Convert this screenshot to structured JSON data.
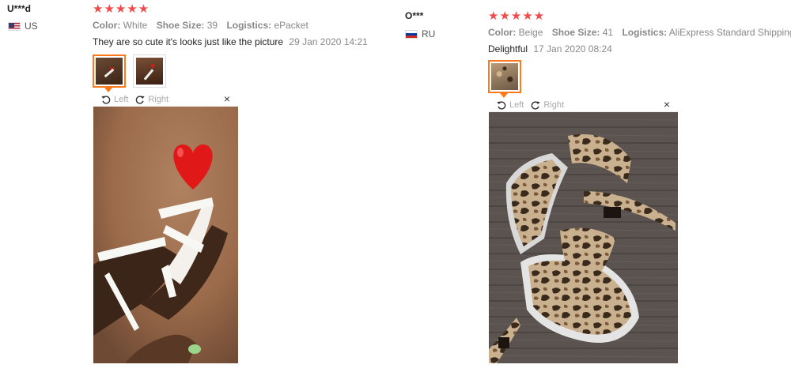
{
  "reviews": [
    {
      "user": "U***d",
      "country": "US",
      "stars": "★★★★★",
      "color_label": "Color:",
      "color_value": "White",
      "size_label": "Shoe Size:",
      "size_value": "39",
      "logistics_label": "Logistics:",
      "logistics_value": "ePacket",
      "text": "They are so cute it's looks just like the picture",
      "date": "29 Jan 2020 14:21",
      "viewer": {
        "left": "Left",
        "right": "Right",
        "close": "×"
      }
    },
    {
      "user": "O***",
      "country": "RU",
      "stars": "★★★★★",
      "color_label": "Color:",
      "color_value": "Beige",
      "size_label": "Shoe Size:",
      "size_value": "41",
      "logistics_label": "Logistics:",
      "logistics_value": "AliExpress Standard Shipping",
      "text": "Delightful",
      "date": "17 Jan 2020 08:24",
      "viewer": {
        "left": "Left",
        "right": "Right",
        "close": "×"
      }
    }
  ],
  "icons": {
    "rotate_left": "rotate-left-icon",
    "rotate_right": "rotate-right-icon",
    "close": "close-icon",
    "heart": "heart-icon"
  },
  "colors": {
    "star": "#f04a4a",
    "active_thumb": "#ff7a1a"
  }
}
